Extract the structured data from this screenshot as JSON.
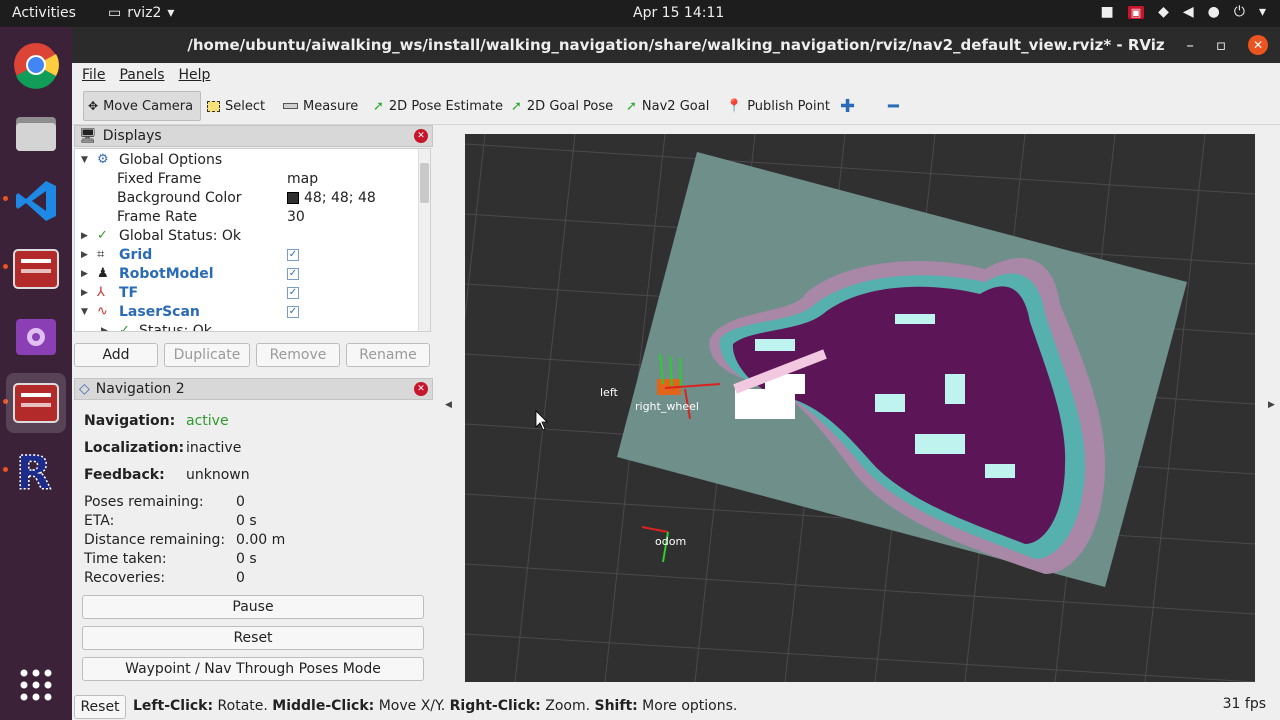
{
  "topbar": {
    "activities": "Activities",
    "app_name": "rviz2",
    "clock": "Apr 15  14:11",
    "tray_icons": [
      "camera-icon",
      "record-icon",
      "wifi-icon",
      "volume-icon",
      "microphone-icon",
      "power-icon",
      "chevron-down-icon"
    ]
  },
  "dock": {
    "items": [
      "chrome-icon",
      "files-icon",
      "vscode-icon",
      "terminal-icon",
      "video-icon",
      "terminal-icon",
      "rviz-icon",
      "apps-grid-icon"
    ]
  },
  "window": {
    "title": "/home/ubuntu/aiwalking_ws/install/walking_navigation/share/walking_navigation/rviz/nav2_default_view.rviz* - RViz"
  },
  "menubar": {
    "file": "File",
    "panels": "Panels",
    "help": "Help"
  },
  "toolbar": {
    "move_camera": "Move Camera",
    "select": "Select",
    "measure": "Measure",
    "pose_estimate": "2D Pose Estimate",
    "goal_pose": "2D Goal Pose",
    "nav2_goal": "Nav2 Goal",
    "publish_point": "Publish Point"
  },
  "displays": {
    "title": "Displays",
    "rows": {
      "global_options": "Global Options",
      "fixed_frame_label": "Fixed Frame",
      "fixed_frame_value": "map",
      "bg_color_label": "Background Color",
      "bg_color_value": "48; 48; 48",
      "frame_rate_label": "Frame Rate",
      "frame_rate_value": "30",
      "global_status": "Global Status: Ok",
      "grid": "Grid",
      "robot_model": "RobotModel",
      "tf": "TF",
      "laser_scan": "LaserScan",
      "status_ok": "Status: Ok"
    },
    "buttons": {
      "add": "Add",
      "duplicate": "Duplicate",
      "remove": "Remove",
      "rename": "Rename"
    }
  },
  "navigation": {
    "title": "Navigation 2",
    "navigation_label": "Navigation:",
    "navigation_value": "active",
    "localization_label": "Localization:",
    "localization_value": "inactive",
    "feedback_label": "Feedback:",
    "feedback_value": "unknown",
    "poses_label": "Poses remaining:",
    "poses_value": "0",
    "eta_label": "ETA:",
    "eta_value": "0 s",
    "distance_label": "Distance remaining:",
    "distance_value": "0.00 m",
    "time_label": "Time taken:",
    "time_value": "0 s",
    "recoveries_label": "Recoveries:",
    "recoveries_value": "0",
    "pause": "Pause",
    "reset": "Reset",
    "waypoint_mode": "Waypoint / Nav Through Poses Mode"
  },
  "viewport": {
    "frame_labels": {
      "left": "left",
      "right_wheel": "right_wheel",
      "odom": "odom"
    }
  },
  "statusbar": {
    "reset": "Reset",
    "left_click_key": "Left-Click:",
    "left_click_val": " Rotate. ",
    "middle_click_key": "Middle-Click:",
    "middle_click_val": " Move X/Y. ",
    "right_click_key": "Right-Click:",
    "right_click_val": " Zoom. ",
    "shift_key": "Shift:",
    "shift_val": " More options.",
    "fps": "31 fps"
  },
  "colors": {
    "accent": "#e95420",
    "dock_bg": "#3b2238",
    "nav_active": "#2e9a2e",
    "tree_blue": "#2a6bb8"
  }
}
